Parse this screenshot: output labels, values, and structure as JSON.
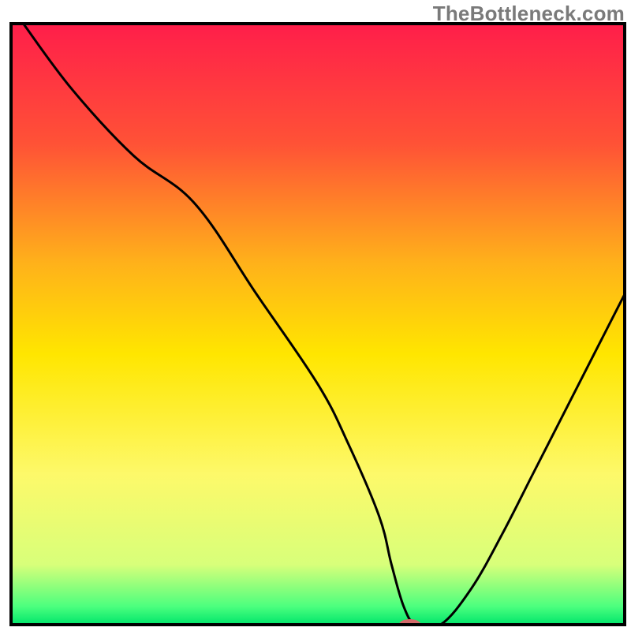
{
  "watermark": "TheBottleneck.com",
  "chart_data": {
    "type": "line",
    "title": "",
    "xlabel": "",
    "ylabel": "",
    "xlim": [
      0,
      100
    ],
    "ylim": [
      0,
      100
    ],
    "x": [
      2,
      10,
      20,
      30,
      40,
      50,
      55,
      60,
      62,
      64,
      66,
      70,
      75,
      80,
      85,
      90,
      95,
      100
    ],
    "values": [
      100,
      89,
      78,
      70,
      55,
      40,
      30,
      18,
      10,
      3,
      0,
      0,
      6,
      15,
      25,
      35,
      45,
      55
    ],
    "gradient_stops": [
      {
        "offset": 0.0,
        "color": "#ff1e4a"
      },
      {
        "offset": 0.2,
        "color": "#ff5236"
      },
      {
        "offset": 0.4,
        "color": "#ffb21a"
      },
      {
        "offset": 0.55,
        "color": "#ffe600"
      },
      {
        "offset": 0.75,
        "color": "#fdf96a"
      },
      {
        "offset": 0.9,
        "color": "#d8ff7a"
      },
      {
        "offset": 0.97,
        "color": "#4bff7e"
      },
      {
        "offset": 1.0,
        "color": "#00e56b"
      }
    ],
    "marker": {
      "x": 65,
      "y": 0,
      "rx": 14,
      "ry": 7,
      "color": "#d46a6a"
    },
    "frame_color": "#000000",
    "curve_color": "#000000"
  }
}
